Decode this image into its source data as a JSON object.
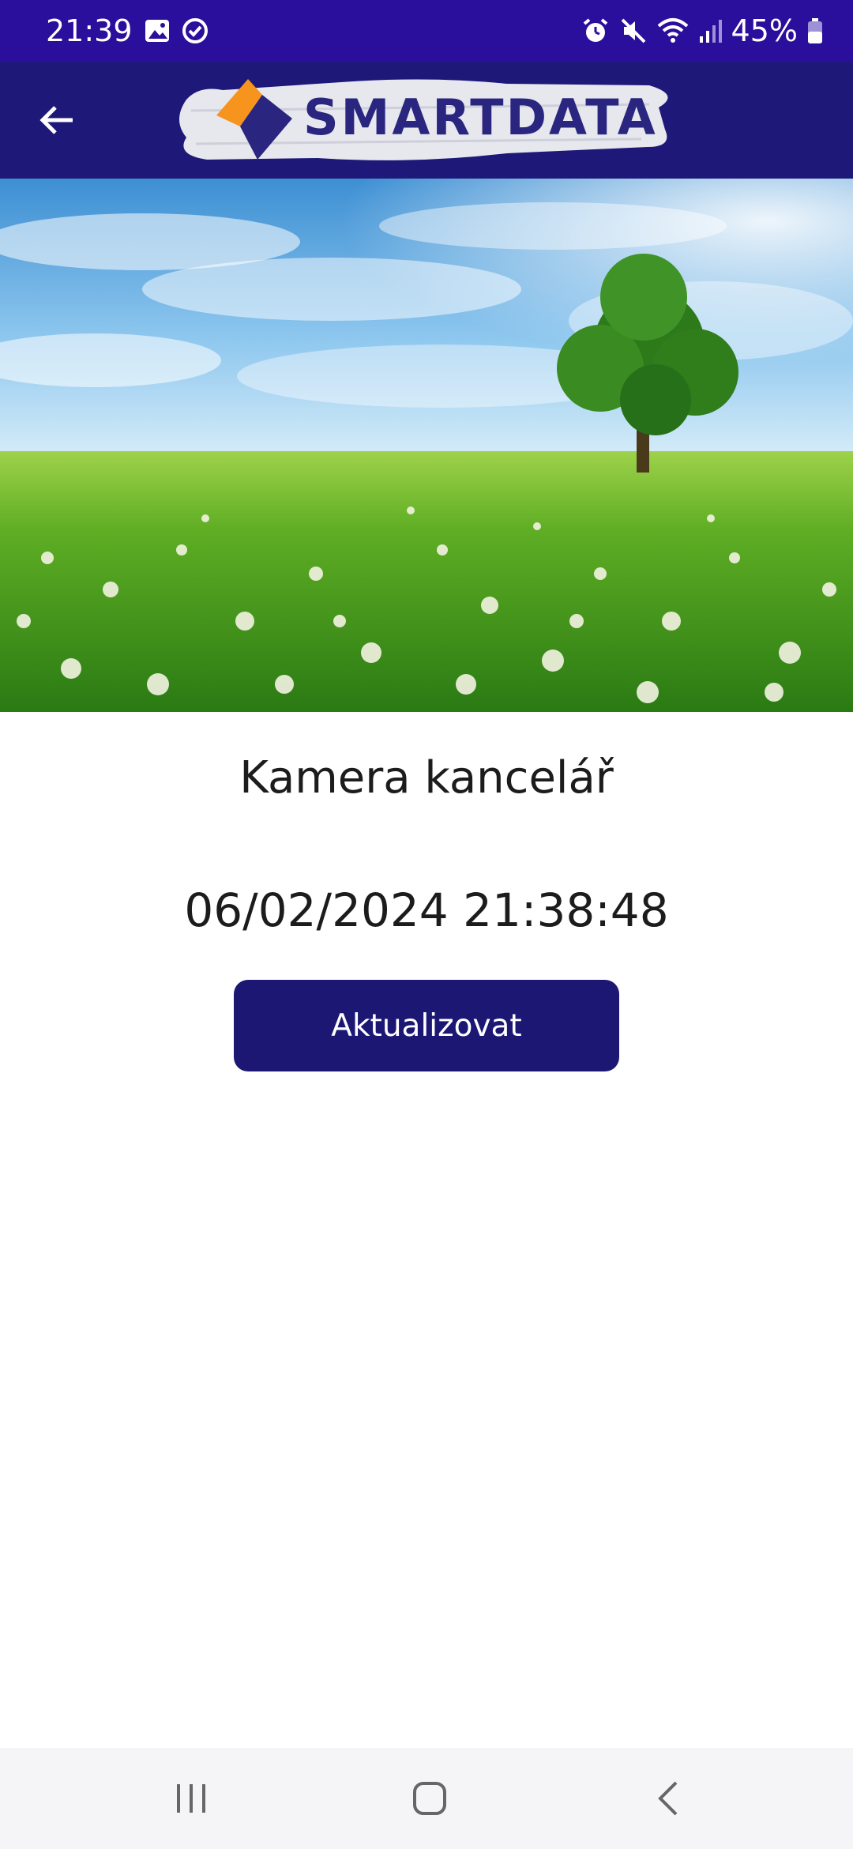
{
  "status_bar": {
    "time": "21:39",
    "battery": "45%",
    "left_icons": [
      "gallery-icon",
      "check-circle-icon"
    ],
    "right_icons": [
      "alarm-icon",
      "mute-icon",
      "wifi-icon",
      "signal-icon",
      "battery-icon"
    ]
  },
  "app_bar": {
    "back_icon": "arrow-left-icon",
    "logo_text": "SMARTDATA",
    "colors": {
      "bar": "#1e1878",
      "logo_orange": "#f7941d",
      "logo_navy": "#2a2680"
    }
  },
  "hero": {
    "description_icon": "landscape-image"
  },
  "camera": {
    "name": "Kamera kancelář",
    "timestamp": "06/02/2024 21:38:48",
    "refresh_label": "Aktualizovat",
    "button_color": "#1c1773"
  },
  "nav_bar": {
    "icons": [
      "recent-apps-icon",
      "home-icon",
      "back-icon"
    ]
  }
}
